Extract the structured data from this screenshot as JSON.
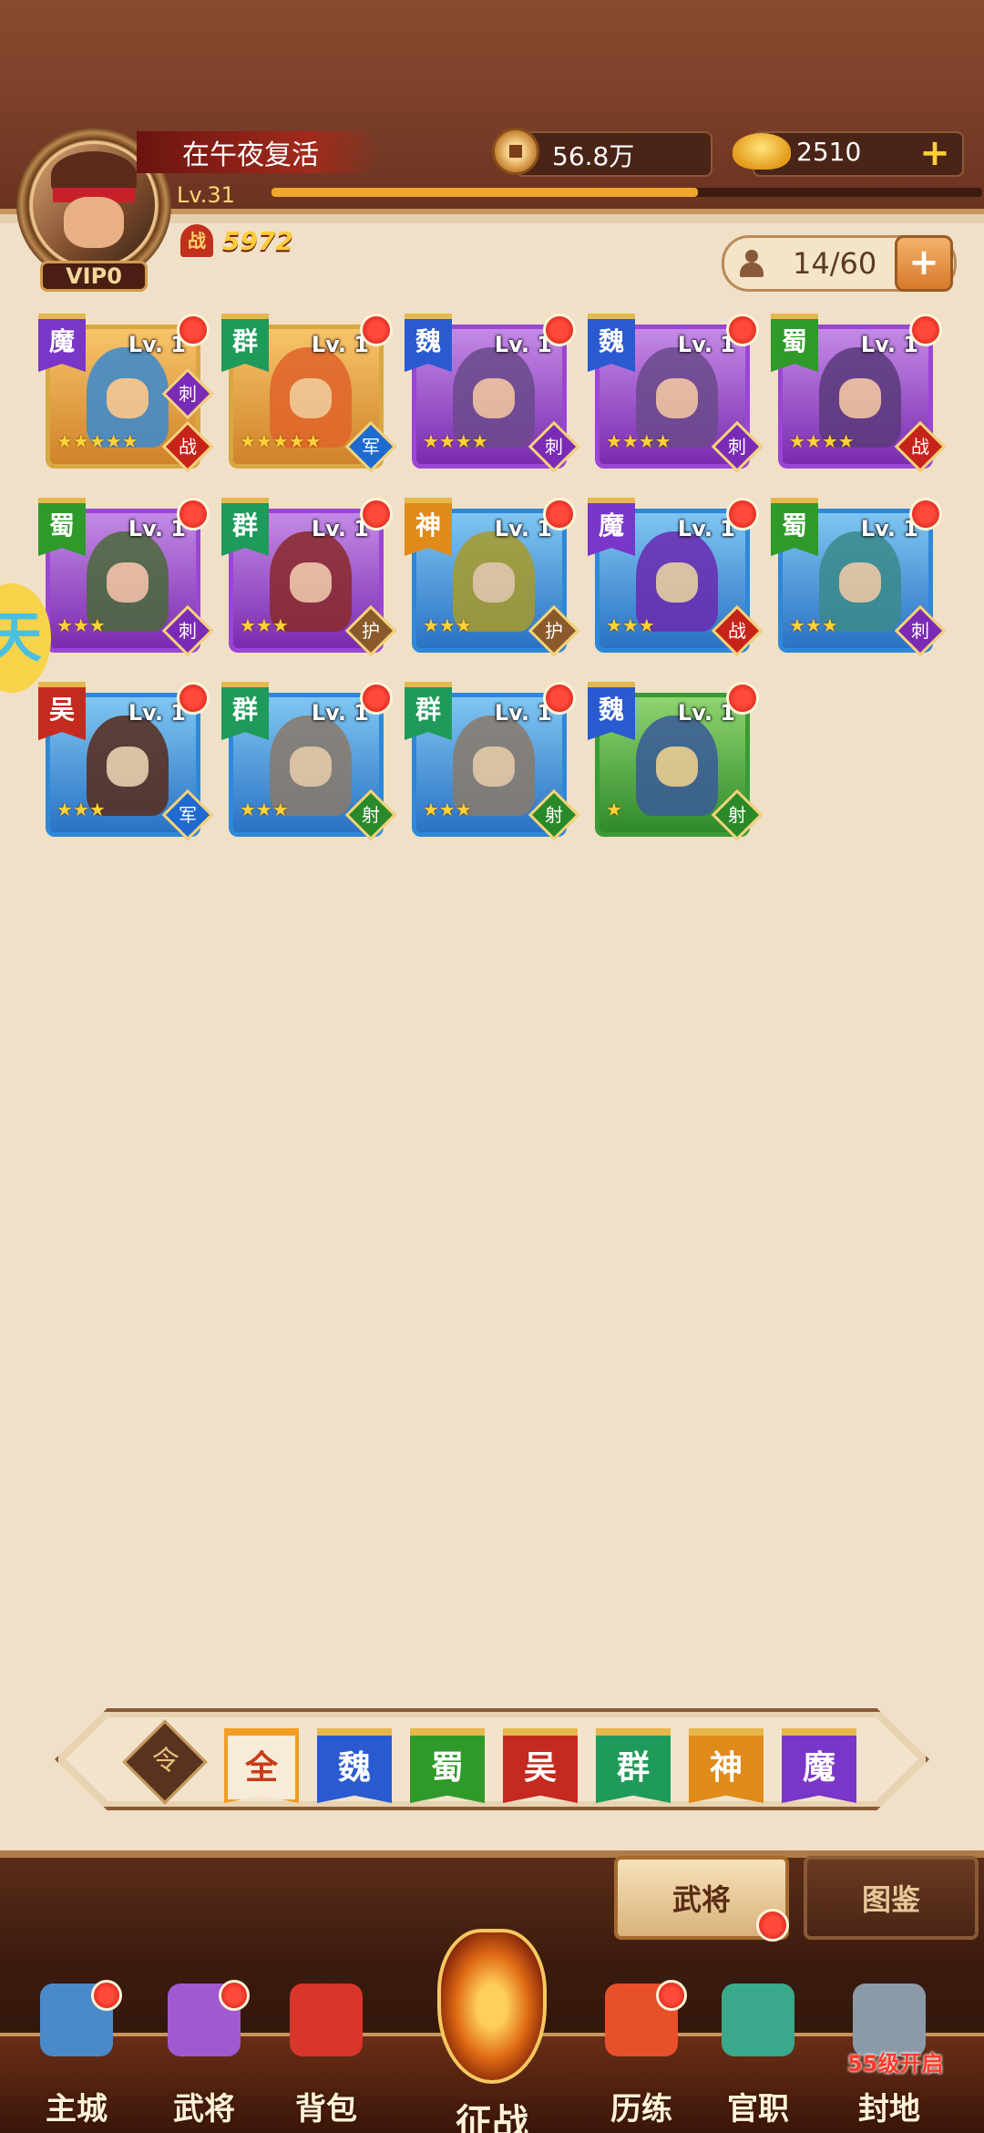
{
  "player": {
    "name": "在午夜复活",
    "level": "Lv.31",
    "vip": "VIP0",
    "power_icon": "战",
    "power": "5972",
    "exp_progress": 0.6
  },
  "currency": {
    "coins": "56.8万",
    "gold": "2510",
    "add": "+"
  },
  "roster": {
    "count": "14/60",
    "add": "+"
  },
  "heroes": [
    {
      "faction": "魔",
      "faction_class": "flag-mo",
      "level": "Lv. 1",
      "stars": "★★★★★",
      "role_top": "刺",
      "role": "战",
      "role_class": "rc-zhan",
      "frame": "gold",
      "art": "#3a8ad0"
    },
    {
      "faction": "群",
      "faction_class": "flag-qun",
      "level": "Lv. 1",
      "stars": "★★★★★",
      "role_top": "",
      "role": "军",
      "role_class": "rc-jun",
      "frame": "gold",
      "art": "#e0642a"
    },
    {
      "faction": "魏",
      "faction_class": "flag-wei",
      "level": "Lv. 1",
      "stars": "★★★★",
      "role_top": "",
      "role": "刺",
      "role_class": "rc-ci",
      "frame": "purple",
      "art": "#6a4a8a"
    },
    {
      "faction": "魏",
      "faction_class": "flag-wei",
      "level": "Lv. 1",
      "stars": "★★★★",
      "role_top": "",
      "role": "刺",
      "role_class": "rc-ci",
      "frame": "purple",
      "art": "#6a4a8a"
    },
    {
      "faction": "蜀",
      "faction_class": "flag-shu",
      "level": "Lv. 1",
      "stars": "★★★★",
      "role_top": "",
      "role": "战",
      "role_class": "rc-zhan",
      "frame": "purple",
      "art": "#5a3a7a"
    },
    {
      "faction": "蜀",
      "faction_class": "flag-shu",
      "level": "Lv. 1",
      "stars": "★★★",
      "role_top": "",
      "role": "刺",
      "role_class": "rc-ci",
      "frame": "purple",
      "art": "#4a6a3a"
    },
    {
      "faction": "群",
      "faction_class": "flag-qun",
      "level": "Lv. 1",
      "stars": "★★★",
      "role_top": "",
      "role": "护",
      "role_class": "rc-hu",
      "frame": "purple",
      "art": "#8a2a2a"
    },
    {
      "faction": "神",
      "faction_class": "flag-shen",
      "level": "Lv. 1",
      "stars": "★★★",
      "role_top": "",
      "role": "护",
      "role_class": "rc-hu",
      "frame": "blue",
      "art": "#a89a2a"
    },
    {
      "faction": "魔",
      "faction_class": "flag-mo",
      "level": "Lv. 1",
      "stars": "★★★",
      "role_top": "",
      "role": "战",
      "role_class": "rc-zhan",
      "frame": "blue",
      "art": "#6a2ab0"
    },
    {
      "faction": "蜀",
      "faction_class": "flag-shu",
      "level": "Lv. 1",
      "stars": "★★★",
      "role_top": "",
      "role": "刺",
      "role_class": "rc-ci",
      "frame": "blue",
      "art": "#3a8a8a"
    },
    {
      "faction": "吴",
      "faction_class": "flag-wu",
      "level": "Lv. 1",
      "stars": "★★★",
      "role_top": "",
      "role": "军",
      "role_class": "rc-jun",
      "frame": "blue",
      "art": "#5a2a1a"
    },
    {
      "faction": "群",
      "faction_class": "flag-qun",
      "level": "Lv. 1",
      "stars": "★★★",
      "role_top": "",
      "role": "射",
      "role_class": "rc-she",
      "frame": "blue",
      "art": "#8a7a6a"
    },
    {
      "faction": "群",
      "faction_class": "flag-qun",
      "level": "Lv. 1",
      "stars": "★★★",
      "role_top": "",
      "role": "射",
      "role_class": "rc-she",
      "frame": "blue",
      "art": "#8a7a6a"
    },
    {
      "faction": "魏",
      "faction_class": "flag-wei",
      "level": "Lv. 1",
      "stars": "★",
      "role_top": "",
      "role": "射",
      "role_class": "rc-she",
      "frame": "green",
      "art": "#3a5a9a"
    }
  ],
  "side_event": "天",
  "filter": {
    "toggle_icon": "令",
    "tabs": [
      {
        "label": "全",
        "cls": "all",
        "color": "#f8ecd8"
      },
      {
        "label": "魏",
        "cls": "flag-wei",
        "color": "#2a5ad0"
      },
      {
        "label": "蜀",
        "cls": "flag-shu",
        "color": "#2f9a2a"
      },
      {
        "label": "吴",
        "cls": "flag-wu",
        "color": "#c42a20"
      },
      {
        "label": "群",
        "cls": "flag-qun",
        "color": "#1f9a5a"
      },
      {
        "label": "神",
        "cls": "flag-shen",
        "color": "#e08a1a"
      },
      {
        "label": "魔",
        "cls": "flag-mo",
        "color": "#7a36c8"
      }
    ]
  },
  "subtabs": {
    "heroes": "武将",
    "codex": "图鉴"
  },
  "nav": {
    "items": [
      {
        "label": "主城",
        "icon": "castle-icon",
        "color": "#4a8ac8",
        "dot": true
      },
      {
        "label": "武将",
        "icon": "general-icon",
        "color": "#a05ad0",
        "dot": true
      },
      {
        "label": "背包",
        "icon": "bag-icon",
        "color": "#d8362a",
        "dot": false
      },
      {
        "label": "历练",
        "icon": "training-icon",
        "color": "#e8502a",
        "dot": true
      },
      {
        "label": "官职",
        "icon": "official-icon",
        "color": "#3aa88a",
        "dot": false
      },
      {
        "label": "封地",
        "icon": "fief-icon",
        "color": "#8a9aa8",
        "dot": false
      }
    ],
    "center": "征战",
    "fief_locked": "55级开启"
  }
}
